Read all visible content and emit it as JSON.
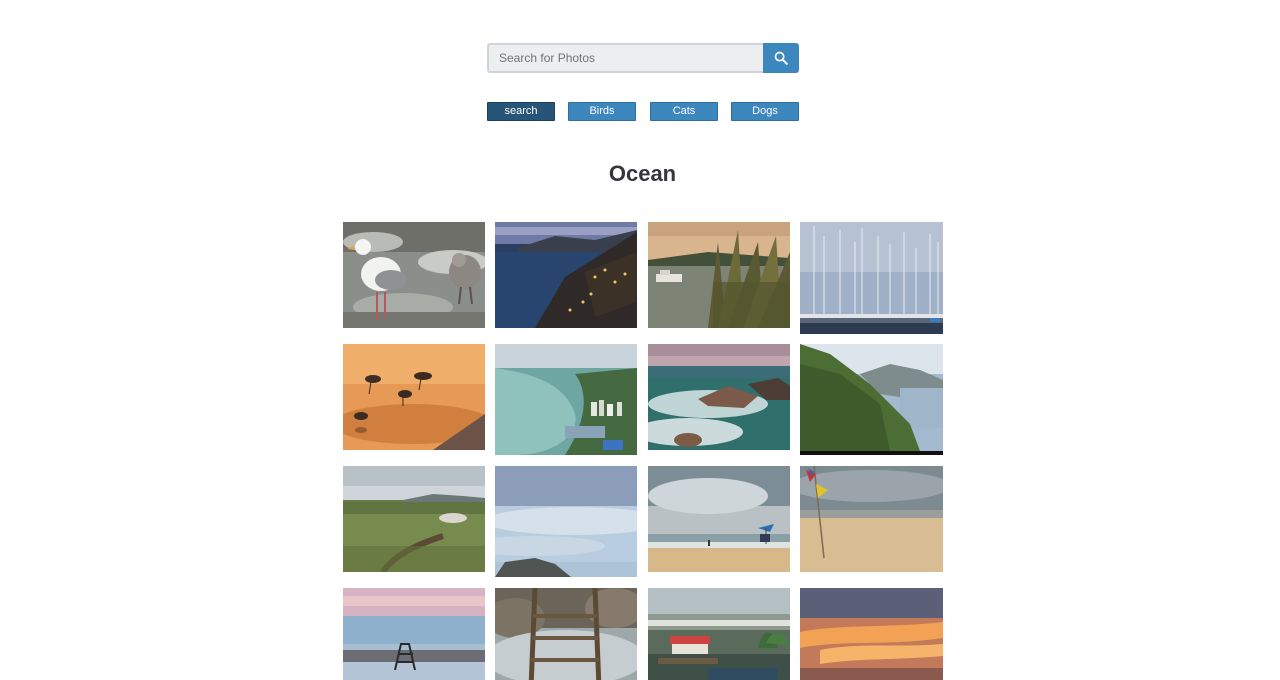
{
  "search": {
    "placeholder": "Search for Photos",
    "value": "",
    "button_icon": "search-icon"
  },
  "topics": [
    {
      "label": "search",
      "active": true
    },
    {
      "label": "Birds",
      "active": false
    },
    {
      "label": "Cats",
      "active": false
    },
    {
      "label": "Dogs",
      "active": false
    }
  ],
  "title": "Ocean",
  "colors": {
    "accent": "#3d87bf",
    "accent_active": "#275477",
    "title": "#34363b",
    "input_bg": "#eceef0"
  },
  "photos": [
    {
      "subject": "seagull-on-rocky-shore"
    },
    {
      "subject": "coastal-village-at-dusk"
    },
    {
      "subject": "boats-behind-reeds"
    },
    {
      "subject": "sailboat-marina"
    },
    {
      "subject": "sandpipers-at-sunset"
    },
    {
      "subject": "aerial-bay-and-city"
    },
    {
      "subject": "waves-over-rocks"
    },
    {
      "subject": "green-coastal-cliffs"
    },
    {
      "subject": "grassy-coastal-field"
    },
    {
      "subject": "cloudy-sky-over-sea"
    },
    {
      "subject": "beach-with-umbrella"
    },
    {
      "subject": "beach-with-flags"
    },
    {
      "subject": "lifeguard-chair-at-sunset"
    },
    {
      "subject": "lifeguard-chair-reflection"
    },
    {
      "subject": "stilt-houses-by-shore"
    },
    {
      "subject": "orange-sunset-clouds"
    }
  ]
}
